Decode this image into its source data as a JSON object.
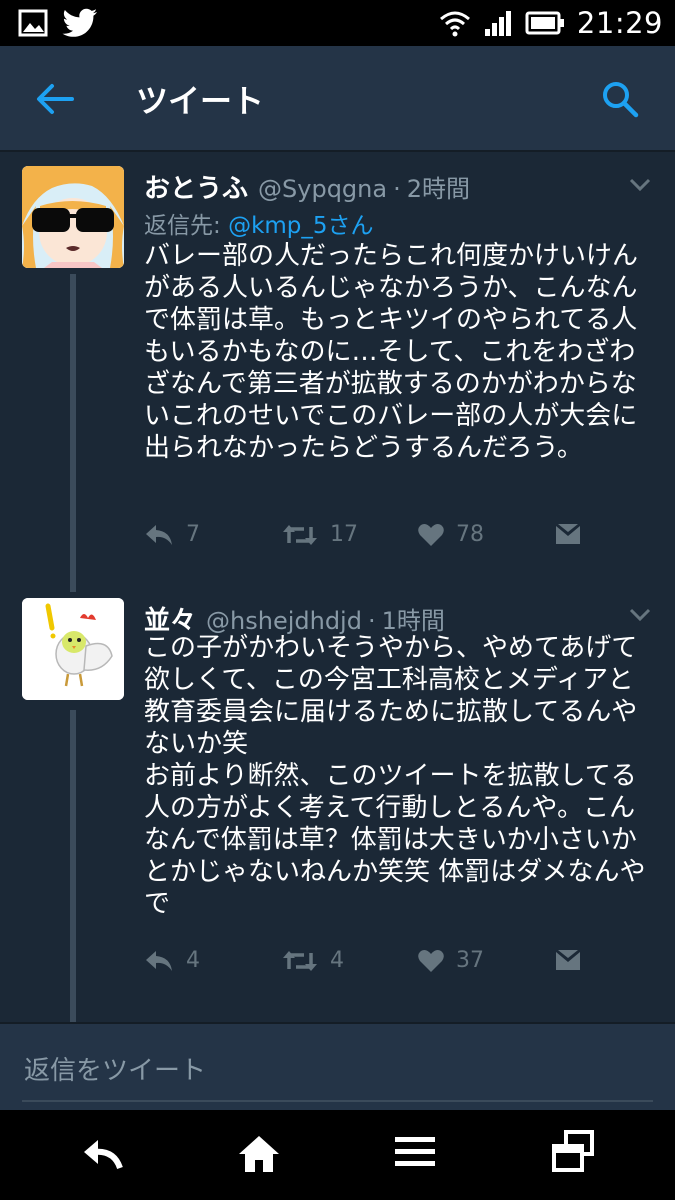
{
  "status_bar": {
    "time": "21:29",
    "icons": [
      "image-icon",
      "twitter-bird-icon",
      "wifi-icon",
      "signal-icon",
      "battery-icon"
    ]
  },
  "header": {
    "title": "ツイート",
    "back_icon": "back-arrow-icon",
    "search_icon": "search-icon"
  },
  "tweets": [
    {
      "name": "おとうふ",
      "handle": "@Sypqgna",
      "time": "2時間",
      "reply_prefix": "返信先:",
      "reply_handle": "@kmp_5さん",
      "text": "バレー部の人だったらこれ何度かけいけんがある人いるんじゃなかろうか、こんなんで体罰は草。もっとキツイのやられてる人もいるかもなのに…そして、これをわざわざなんで第三者が拡散するのかがわからないこれのせいでこのバレー部の人が大会に出られなかったらどうするんだろう。",
      "replies": "7",
      "retweets": "17",
      "likes": "78"
    },
    {
      "name": "並々",
      "handle": "@hshejdhdjd",
      "time": "1時間",
      "text": "この子がかわいそうやから、やめてあげて欲しくて、この今宮工科高校とメディアと教育委員会に届けるために拡散してるんやないか笑\nお前より断然、このツイートを拡散してる人の方がよく考えて行動しとるんや。こんなんで体罰は草？体罰は大きいか小さいかとかじゃないねんか笑笑 体罰はダメなんやで",
      "replies": "4",
      "retweets": "4",
      "likes": "37"
    }
  ],
  "separator": "·",
  "reply_box": {
    "placeholder": "返信をツイート"
  },
  "nav_bar": {
    "icons": [
      "back-icon",
      "home-icon",
      "menu-icon",
      "recent-apps-icon"
    ]
  },
  "colors": {
    "background": "#1b2836",
    "header": "#243447",
    "accent": "#1da1f2",
    "secondary_text": "#8899a6",
    "action_icon": "#66757f"
  }
}
